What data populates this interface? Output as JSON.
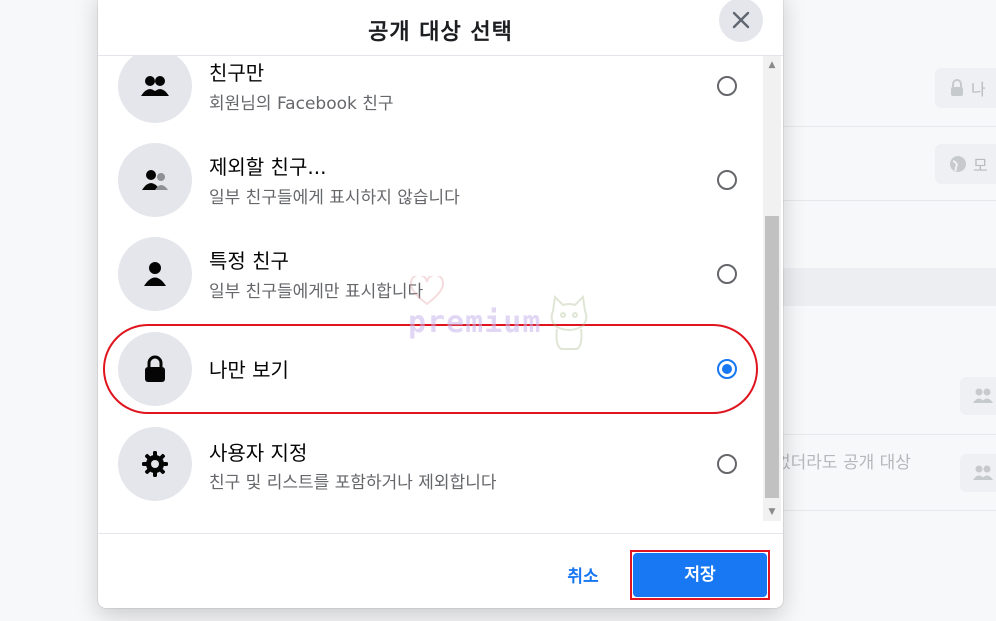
{
  "dialog": {
    "title": "공개 대상 선택",
    "close_icon": "close-icon",
    "options": [
      {
        "label": "친구만",
        "desc": "회원님의 Facebook 친구",
        "icon": "friends-icon",
        "selected": false
      },
      {
        "label": "제외할 친구...",
        "desc": "일부 친구들에게 표시하지 않습니다",
        "icon": "friends-except-icon",
        "selected": false
      },
      {
        "label": "특정 친구",
        "desc": "일부 친구들에게만 표시합니다",
        "icon": "person-icon",
        "selected": false
      },
      {
        "label": "나만 보기",
        "desc": "",
        "icon": "lock-icon",
        "selected": true
      },
      {
        "label": "사용자 지정",
        "desc": "친구 및 리스트를 포함하거나 제외합니다",
        "icon": "gear-icon",
        "selected": false
      }
    ],
    "cancel_label": "취소",
    "save_label": "저장"
  },
  "background": {
    "btn1_label": "나",
    "btn2_label": "모",
    "partial_text": "없더라도 공개 대상"
  },
  "watermark": "premium",
  "colors": {
    "accent": "#1877f2",
    "highlight": "#e0141e"
  }
}
